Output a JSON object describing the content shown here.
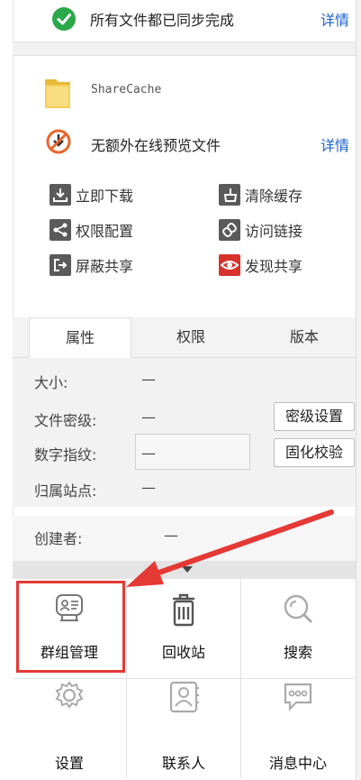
{
  "sync_status": {
    "text": "所有文件都已同步完成",
    "detail_link": "详情",
    "icon": "check-circle-icon"
  },
  "file": {
    "name": "ShareCache",
    "icon": "folder-icon"
  },
  "preview_status": {
    "text": "无额外在线预览文件",
    "detail_link": "详情",
    "icon": "no-preview-icon"
  },
  "actions": [
    {
      "label": "立即下载",
      "icon": "download-icon"
    },
    {
      "label": "清除缓存",
      "icon": "broom-icon"
    },
    {
      "label": "权限配置",
      "icon": "share-nodes-icon"
    },
    {
      "label": "访问链接",
      "icon": "link-icon"
    },
    {
      "label": "屏蔽共享",
      "icon": "exit-icon"
    },
    {
      "label": "发现共享",
      "icon": "eye-icon"
    }
  ],
  "tabs": [
    {
      "label": "属性",
      "active": true
    },
    {
      "label": "权限",
      "active": false
    },
    {
      "label": "版本",
      "active": false
    }
  ],
  "properties": {
    "size": {
      "label": "大小:",
      "value": "—"
    },
    "security_level": {
      "label": "文件密级:",
      "value": "—",
      "button": "密级设置"
    },
    "fingerprint": {
      "label": "数字指纹:",
      "value": "—",
      "button": "固化校验"
    },
    "site": {
      "label": "归属站点:",
      "value": "—"
    },
    "creator": {
      "label": "创建者:",
      "value": "—"
    }
  },
  "bottom_menu": [
    {
      "label": "群组管理",
      "icon": "group-card-icon",
      "highlighted": true
    },
    {
      "label": "回收站",
      "icon": "trash-icon"
    },
    {
      "label": "搜索",
      "icon": "search-icon"
    },
    {
      "label": "设置",
      "icon": "gear-icon"
    },
    {
      "label": "联系人",
      "icon": "contact-book-icon"
    },
    {
      "label": "消息中心",
      "icon": "message-bubble-icon"
    }
  ],
  "colors": {
    "link": "#1d63c9",
    "success": "#2aa84a",
    "alert": "#e53935",
    "icon_gray": "#555555"
  }
}
